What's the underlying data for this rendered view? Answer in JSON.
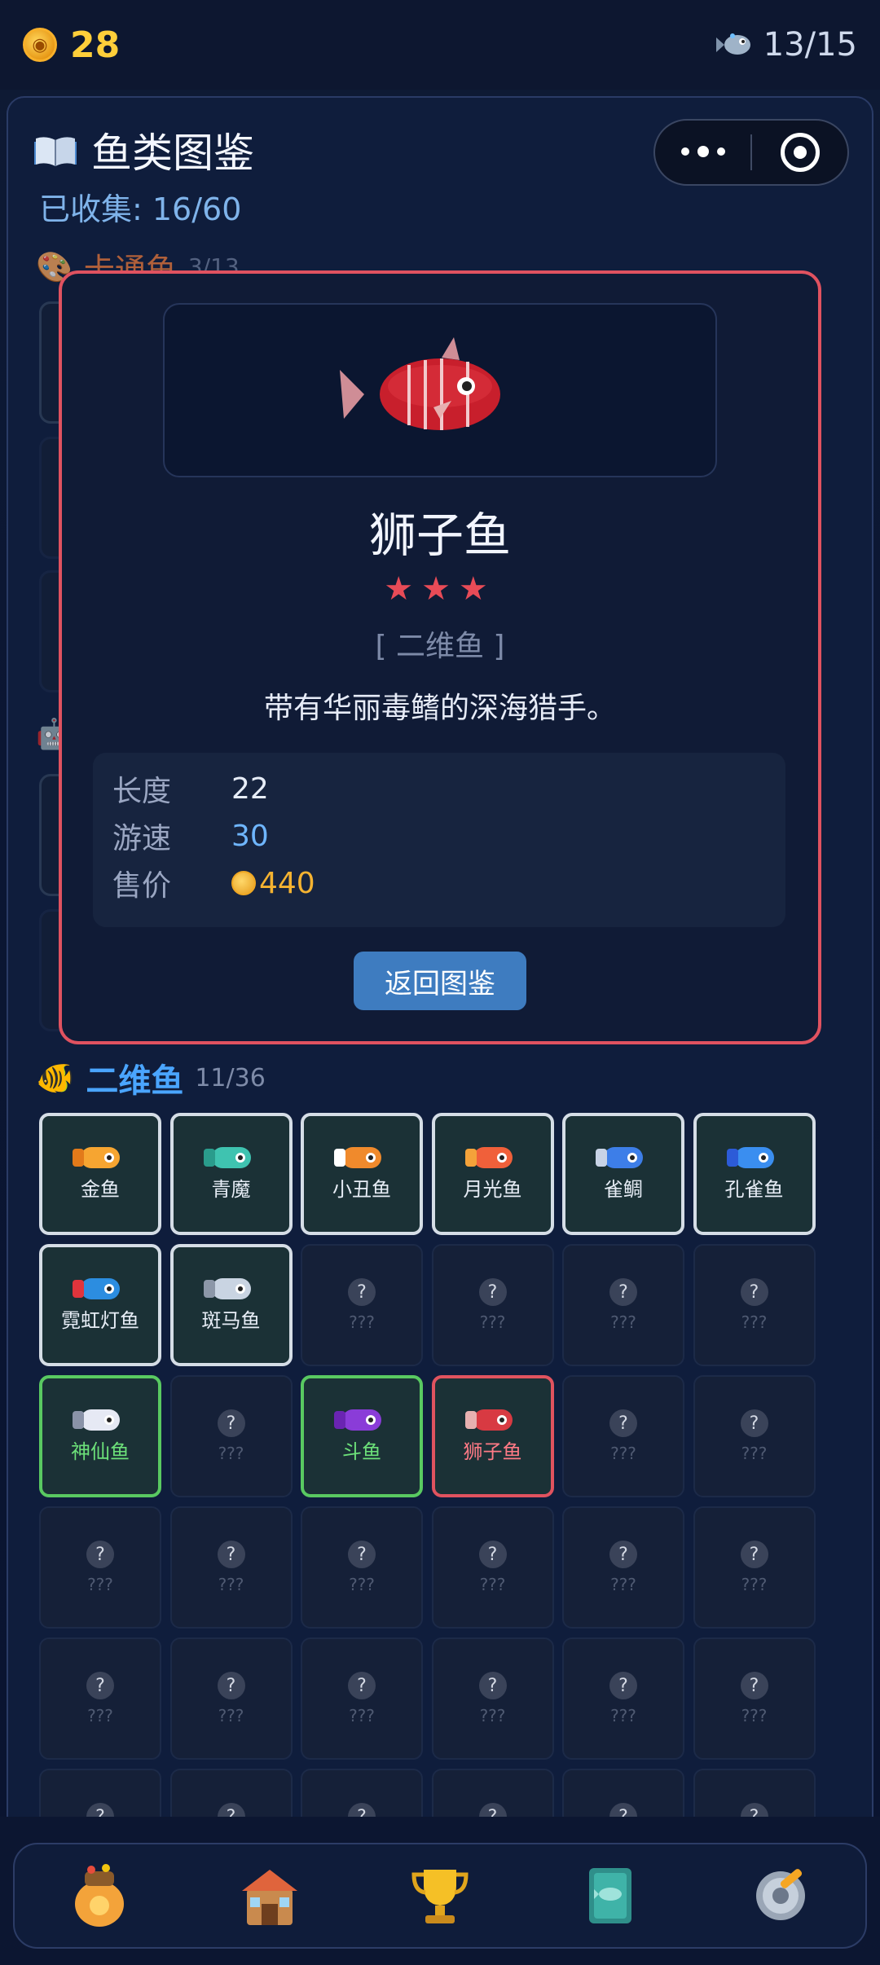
{
  "status": {
    "coins": "28",
    "coin_glyph": "◉",
    "tank": "13/15"
  },
  "header": {
    "title": "鱼类图鉴",
    "collected": "已收集: 16/60"
  },
  "categories": {
    "cartoon": {
      "name": "卡通鱼",
      "count": "3/13"
    }
  },
  "modal": {
    "name": "狮子鱼",
    "stars": "★★★",
    "category": "[ 二维鱼 ]",
    "description": "带有华丽毒鳍的深海猎手。",
    "stats": [
      {
        "label": "长度",
        "value": "22"
      },
      {
        "label": "游速",
        "value": "30"
      },
      {
        "label": "售价",
        "value": "440"
      }
    ],
    "back_button": "返回图鉴"
  },
  "section_2d": {
    "name": "二维鱼",
    "count": "11/36"
  },
  "grid": {
    "unknown_mark": "?",
    "unknown_label": "???",
    "owned": [
      {
        "label": "金鱼",
        "body": "#f6a531",
        "tail": "#e27a1a"
      },
      {
        "label": "青魔",
        "body": "#3fc3b0",
        "tail": "#2a9c8c"
      },
      {
        "label": "小丑鱼",
        "body": "#f08a2c",
        "tail": "#ffffff"
      },
      {
        "label": "月光鱼",
        "body": "#f0603a",
        "tail": "#f4a23a"
      },
      {
        "label": "雀鲷",
        "body": "#3d7ee8",
        "tail": "#c8d3e6"
      },
      {
        "label": "孔雀鱼",
        "body": "#3a8ef0",
        "tail": "#2c5bd8"
      },
      {
        "label": "霓虹灯鱼",
        "body": "#2c8de0",
        "tail": "#e0343c"
      },
      {
        "label": "斑马鱼",
        "body": "#c9d4e2",
        "tail": "#8c97a8"
      },
      {
        "label": "神仙鱼",
        "body": "#e6e9f4",
        "tail": "#8a93a8"
      },
      {
        "label": "斗鱼",
        "body": "#8a3cd8",
        "tail": "#6a24b2"
      },
      {
        "label": "狮子鱼",
        "body": "#d83a42",
        "tail": "#e7b0b0"
      }
    ]
  },
  "nav": {
    "items": [
      "bag-icon",
      "shop-icon",
      "trophy-icon",
      "book-icon",
      "settings-icon"
    ]
  }
}
